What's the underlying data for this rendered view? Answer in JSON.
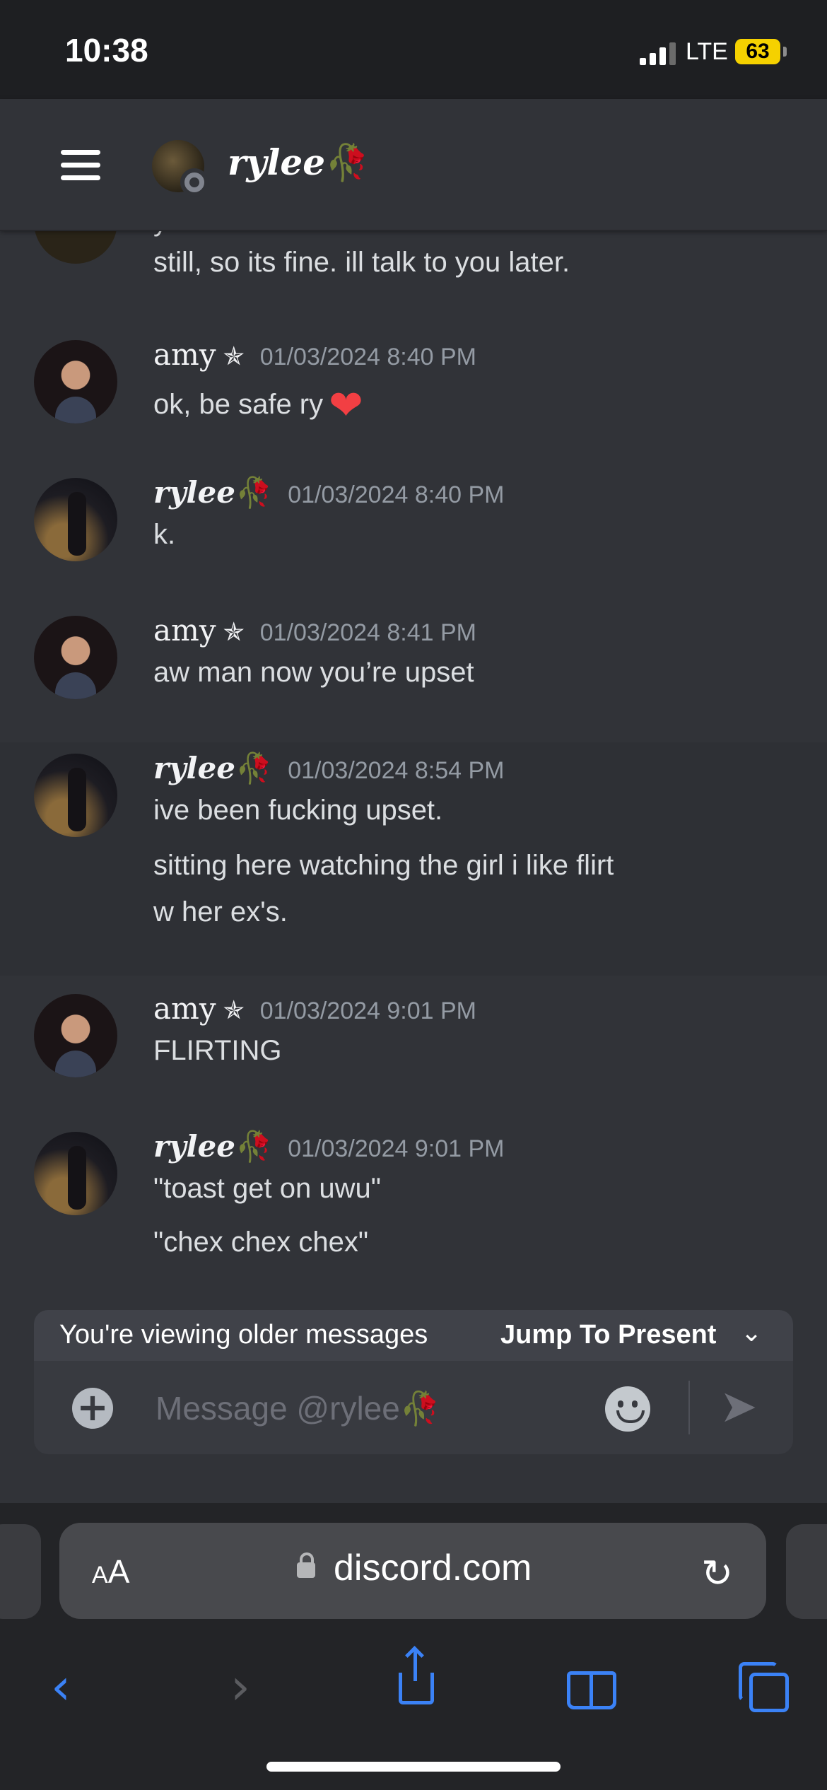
{
  "status_bar": {
    "time": "10:38",
    "network": "LTE",
    "battery": "63"
  },
  "header": {
    "channel_name": "rylee",
    "name_glyph": "🥀"
  },
  "chat": {
    "cut_line_1": "you seem so better w chex nd toast",
    "cut_line_2": "still, so its fine. ill talk to you later.",
    "messages": [
      {
        "author": "amy",
        "author_suffix": "✯",
        "timestamp": "01/03/2024 8:40 PM",
        "lines": [
          "ok, be safe ry"
        ],
        "emoji": "❤"
      },
      {
        "author": "rylee",
        "author_suffix": "🥀",
        "timestamp": "01/03/2024 8:40 PM",
        "lines": [
          "k."
        ]
      },
      {
        "author": "amy",
        "author_suffix": "✯",
        "timestamp": "01/03/2024 8:41 PM",
        "lines": [
          "aw man now you’re upset"
        ]
      },
      {
        "author": "rylee",
        "author_suffix": "🥀",
        "timestamp": "01/03/2024 8:54 PM",
        "lines": [
          "ive been fucking upset.",
          "sitting here watching the girl i like flirt",
          "w her ex's."
        ]
      },
      {
        "author": "amy",
        "author_suffix": "✯",
        "timestamp": "01/03/2024 9:01 PM",
        "lines": [
          "FLIRTING"
        ]
      },
      {
        "author": "rylee",
        "author_suffix": "🥀",
        "timestamp": "01/03/2024 9:01 PM",
        "lines": [
          "\"toast get on uwu\"",
          "\"chex chex chex\""
        ]
      }
    ]
  },
  "older_banner": {
    "text": "You're viewing older messages",
    "jump_label": "Jump To Present"
  },
  "composer": {
    "placeholder": "Message @rylee🥀"
  },
  "safari": {
    "aa_small": "A",
    "aa_big": "A",
    "url": "discord.com"
  }
}
